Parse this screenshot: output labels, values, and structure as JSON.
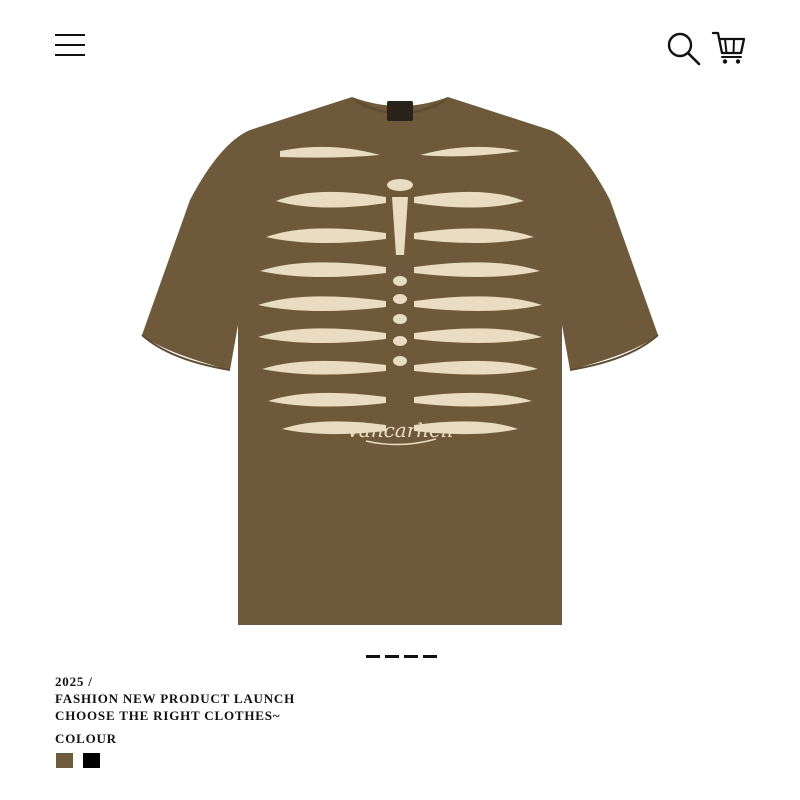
{
  "header": {
    "menu_icon": "hamburger-menu-icon",
    "search_icon": "search-icon",
    "cart_icon": "shopping-cart-icon"
  },
  "product": {
    "image_subject": "skeleton-ribcage-tshirt",
    "shirt_color": "#6e5a3a",
    "print_color": "#e9dcc0",
    "brand_logo": "Vancarhell",
    "carousel_count": 4
  },
  "info": {
    "year": "2025 /",
    "headline_1": "FASHION NEW PRODUCT LAUNCH",
    "headline_2": "CHOOSE THE RIGHT CLOTHES~",
    "colour_label": "COLOUR",
    "colours": [
      "#6d5c3d",
      "#000000"
    ]
  }
}
